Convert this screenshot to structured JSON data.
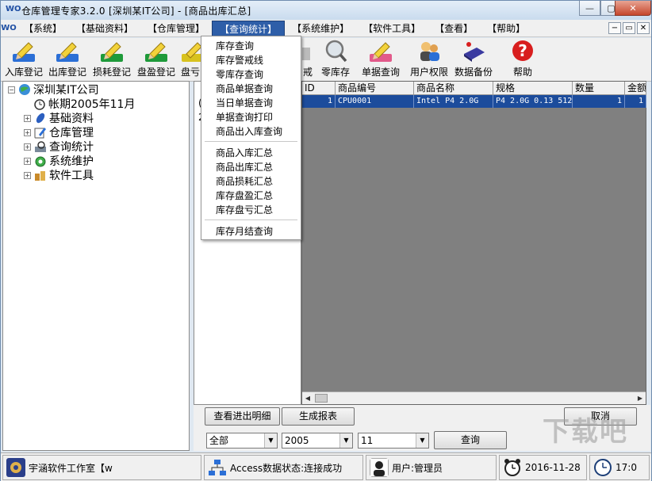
{
  "window": {
    "title": "仓库管理专家3.2.0  [深圳某IT公司] - [商品出库汇总]",
    "app_logo": "WO",
    "controls": {
      "minimize": "—",
      "maximize": "▢",
      "close": "✕"
    }
  },
  "menu": {
    "logo": "WO",
    "items": [
      "【系统】",
      "【基础资料】",
      "【仓库管理】",
      "【查询统计】",
      "【系统维护】",
      "【软件工具】",
      "【查看】",
      "【帮助】"
    ],
    "active_index": 3,
    "mdi_controls": [
      "−",
      "▭",
      "✕"
    ]
  },
  "toolbar": {
    "buttons": [
      {
        "label": "入库登记",
        "icon": "inbound-pencil-icon",
        "color": "#2b6fd6"
      },
      {
        "label": "出库登记",
        "icon": "outbound-pencil-icon",
        "color": "#2b6fd6"
      },
      {
        "label": "损耗登记",
        "icon": "loss-pencil-icon",
        "color": "#1e9a3a"
      },
      {
        "label": "盘盈登记",
        "icon": "surplus-pencil-icon",
        "color": "#1e9a3a"
      },
      {
        "label": "盘亏",
        "icon": "shortage-pencil-icon",
        "color": "#d8c21e"
      },
      {
        "label": "戒",
        "icon": "warning-icon",
        "color": "#888888"
      },
      {
        "label": "零库存",
        "icon": "magnifier-icon",
        "color": "#888888"
      },
      {
        "label": "单据查询",
        "icon": "doc-query-pencil-icon",
        "color": "#e25a8a"
      },
      {
        "label": "用户权限",
        "icon": "users-icon",
        "color": "#e0b04a"
      },
      {
        "label": "数据备份",
        "icon": "backup-icon",
        "color": "#3a3aa0"
      },
      {
        "label": "帮助",
        "icon": "help-icon",
        "color": "#d81e1e"
      }
    ]
  },
  "tree": {
    "root": "深圳某IT公司",
    "period": "帐期2005年11月",
    "nodes": [
      "基础资料",
      "仓库管理",
      "查询统计",
      "系统维护",
      "软件工具"
    ]
  },
  "dropdown": {
    "group1": [
      "库存查询",
      "库存警戒线",
      "零库存查询",
      "商品单据查询",
      "当日单据查询",
      "单据查询打印",
      "商品出入库查询"
    ],
    "group2": [
      "商品入库汇总",
      "商品出库汇总",
      "商品损耗汇总",
      "库存盘盈汇总",
      "库存盘亏汇总"
    ],
    "group3": [
      "库存月结查询"
    ]
  },
  "mid_pane": {
    "cut_chars": [
      "(",
      "2"
    ]
  },
  "grid": {
    "columns": [
      "ID",
      "商品编号",
      "商品名称",
      "规格",
      "数量",
      "金额"
    ],
    "rows": [
      [
        "1",
        "CPU0001",
        "Intel P4 2.0G",
        "P4 2.0G 0.13 512",
        "1",
        "1"
      ]
    ]
  },
  "scroll": {
    "left": "◀",
    "right": "▶"
  },
  "actions": {
    "view_detail": "查看进出明细",
    "generate_report": "生成报表",
    "cancel": "取消",
    "query": "查询"
  },
  "filters": {
    "scope": "全部",
    "year": "2005",
    "month": "11"
  },
  "status": {
    "studio": "宇涵软件工作室【w",
    "db": "Access数据状态:连接成功",
    "user": "用户:管理员",
    "date": "2016-11-28",
    "time": "17:0"
  },
  "watermark": "下载吧"
}
